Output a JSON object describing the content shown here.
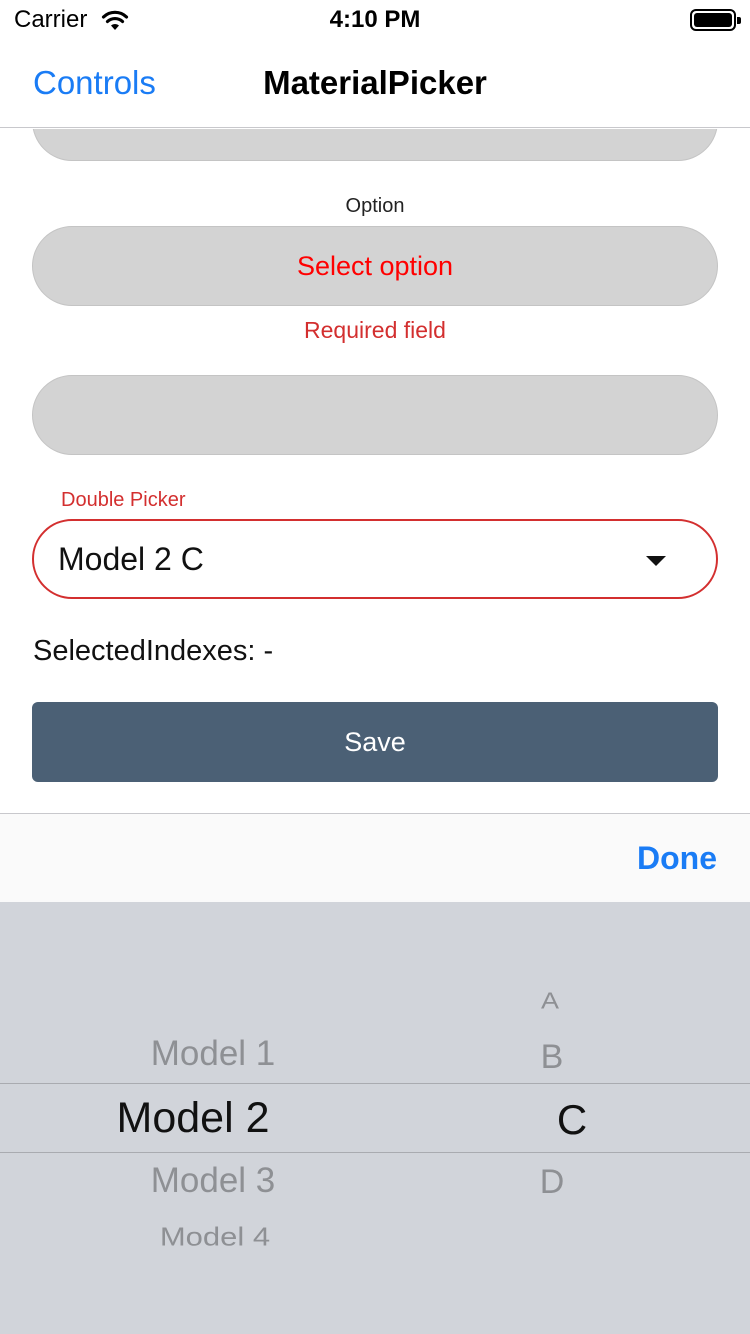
{
  "status_bar": {
    "carrier": "Carrier",
    "time": "4:10 PM",
    "wifi_icon": "wifi-icon",
    "battery_icon": "battery-icon"
  },
  "nav": {
    "back_label": "Controls",
    "title": "MaterialPicker"
  },
  "form": {
    "option_label": "Option",
    "option_placeholder": "Select option",
    "option_error": "Required field",
    "double_picker_label": "Double Picker",
    "double_picker_value": "Model 2 C",
    "dropdown_icon": "chevron-down-icon",
    "selected_indexes": "SelectedIndexes: -",
    "save_label": "Save"
  },
  "picker": {
    "done_label": "Done",
    "column_1": [
      "Model 1",
      "Model 2",
      "Model 3",
      "Model 4"
    ],
    "column_1_selected": "Model 2",
    "column_2": [
      "A",
      "B",
      "C",
      "D"
    ],
    "column_2_selected": "C"
  },
  "colors": {
    "accent": "#1a7cf5",
    "error": "#d32f2f",
    "save_button": "#4b6075",
    "picker_background": "#d1d4da"
  }
}
